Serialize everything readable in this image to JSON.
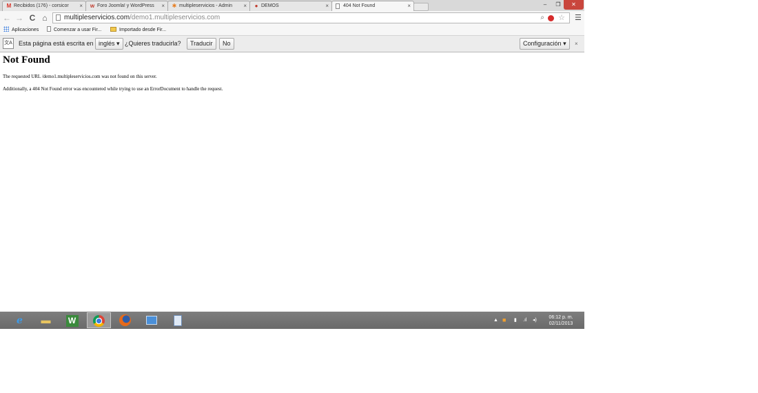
{
  "tabs": [
    {
      "favicon": "gmail-icon",
      "title": "Recibidos (176) - corsicor",
      "active": false
    },
    {
      "favicon": "wordpress-icon",
      "title": "Foro Joomla! y WordPress",
      "active": false
    },
    {
      "favicon": "joomla-icon",
      "title": "multipleservicios - Admin",
      "active": false
    },
    {
      "favicon": "demos-icon",
      "title": "DEMOS",
      "active": false
    },
    {
      "favicon": "page-icon",
      "title": "404 Not Found",
      "active": true
    }
  ],
  "toolbar": {
    "url_host": "multipleservicios.com",
    "url_path": "/demo1.multipleservicios.com"
  },
  "bookmarks": [
    {
      "icon": "apps-grid-icon",
      "label": "Aplicaciones"
    },
    {
      "icon": "page-icon",
      "label": "Comenzar a usar Fir..."
    },
    {
      "icon": "folder-icon",
      "label": "Importado desde Fir..."
    }
  ],
  "infobar": {
    "prefix": "Esta página está escrita en",
    "language": "inglés",
    "question": "¿Quieres traducirla?",
    "translate_label": "Traducir",
    "no_label": "No",
    "settings_label": "Configuración"
  },
  "page": {
    "heading": "Not Found",
    "p1": "The requested URL /demo1.multipleservicios.com was not found on this server.",
    "p2": "Additionally, a 404 Not Found error was encountered while trying to use an ErrorDocument to handle the request."
  },
  "taskbar": {
    "apps": [
      "internet-explorer-icon",
      "file-explorer-icon",
      "wordpad-icon",
      "chrome-icon",
      "firefox-icon",
      "network-icon",
      "calculator-icon"
    ],
    "active_app": "chrome-icon",
    "clock_time": "06:12 p. m.",
    "clock_date": "02/11/2013"
  },
  "colors": {
    "close_button": "#c9463d",
    "taskbar": "#747474",
    "infobar": "#ececec"
  }
}
